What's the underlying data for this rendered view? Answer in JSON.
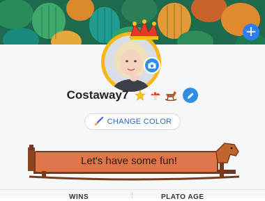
{
  "profile": {
    "username": "Costaway7",
    "badges": [
      "star-badge",
      "mushroom-badge",
      "horse-badge"
    ]
  },
  "actions": {
    "change_color_label": "CHANGE COLOR",
    "fab_symbol": "+"
  },
  "banner": {
    "text": "Let's have some fun!"
  },
  "stats": {
    "wins_label": "WINS",
    "plato_age_label": "PLATO AGE"
  },
  "colors": {
    "accent_blue": "#2f8de4",
    "avatar_ring": "#f7b816",
    "banner_fill": "#e0744a",
    "header_green": "#1f6b4a"
  },
  "icons": {
    "camera": "camera-icon",
    "edit": "pencil-icon",
    "brush": "paintbrush-icon",
    "crown": "jester-hat-icon",
    "add": "plus-icon"
  }
}
